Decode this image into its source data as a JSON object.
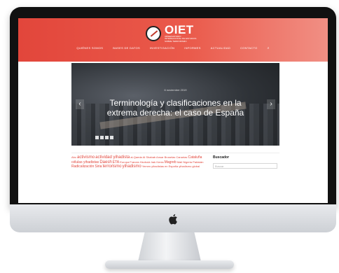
{
  "site": {
    "logo_text": "OIET",
    "logo_subtitle": "OBSERVATORIO INTERNACIONAL DE ESTUDIOS SOBRE TERRORISMO"
  },
  "nav": {
    "items": [
      "Quiénes somos",
      "Bases de datos",
      "Investigación",
      "Informes",
      "Actualidad",
      "Contacto"
    ]
  },
  "hero": {
    "meta": "6 noviembre 2019",
    "title": "Terminología y clasificaciones en la extrema derecha: el caso de España"
  },
  "tags": {
    "items": [
      "Abc",
      "activismo",
      "actividad yihadista",
      "al-Qaeda",
      "Al Shabab",
      "Ansar",
      "Bruselas",
      "Canarias",
      "Cataluña",
      "células yihadistas",
      "Daesh",
      "ETA",
      "Europa",
      "Francia",
      "Hezbolá",
      "Irak",
      "Kenia",
      "Magreb",
      "Mali",
      "Nigeria",
      "Pakistán",
      "Radicalización",
      "Siria",
      "terrorismo",
      "yihadismo",
      "Yemen",
      "yihadistas en España",
      "yihadismo global"
    ]
  },
  "sidebar": {
    "title": "Buscador",
    "search_placeholder": "Buscar"
  },
  "colors": {
    "accent": "#e2463b"
  }
}
